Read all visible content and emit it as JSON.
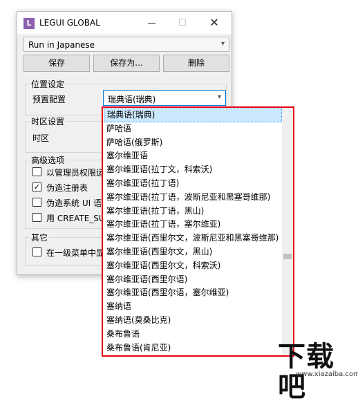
{
  "window": {
    "title": "LEGUI GLOBAL",
    "icon_letter": "L"
  },
  "profile_select": {
    "value": "Run in Japanese"
  },
  "buttons": {
    "save": "保存",
    "save_as": "保存为...",
    "delete": "删除"
  },
  "location_group": {
    "title": "位置设定",
    "preset_label": "预置配置",
    "preset_value": "瑞典语(瑞典)"
  },
  "timezone_group": {
    "title": "时区设置",
    "timezone_label": "时区"
  },
  "advanced_group": {
    "title": "高级选项",
    "options": [
      {
        "label": "以管理员权限运",
        "checked": false
      },
      {
        "label": "伪造注册表",
        "checked": true
      },
      {
        "label": "伪造系统 UI 语",
        "checked": false
      },
      {
        "label": "用 CREATE_SU",
        "checked": false
      }
    ]
  },
  "other_group": {
    "title": "其它",
    "options": [
      {
        "label": "在一级菜单中显",
        "checked": false
      }
    ]
  },
  "dropdown": {
    "selected_index": 0,
    "items": [
      "瑞典语(瑞典)",
      "萨哈语",
      "萨哈语(俄罗斯)",
      "塞尔维亚语",
      "塞尔维亚语(拉丁文，科索沃)",
      "塞尔维亚语(拉丁语)",
      "塞尔维亚语(拉丁语，波斯尼亚和黑塞哥维那)",
      "塞尔维亚语(拉丁语，黑山)",
      "塞尔维亚语(拉丁语，塞尔维亚)",
      "塞尔维亚语(西里尔文，波斯尼亚和黑塞哥维那)",
      "塞尔维亚语(西里尔文，黑山)",
      "塞尔维亚语(西里尔文，科索沃)",
      "塞尔维亚语(西里尔语)",
      "塞尔维亚语(西里尔语，塞尔维亚)",
      "塞纳语",
      "塞纳语(莫桑比克)",
      "桑布鲁语",
      "桑布鲁语(肯尼亚)"
    ]
  },
  "watermark": {
    "main": "下载吧",
    "sub": "www.xiazaiba.com"
  },
  "colors": {
    "highlight": "#e60012",
    "selection": "#cce8ff",
    "focus_border": "#0078d7"
  },
  "icons": {
    "dropdown_arrow": "chevron-down-icon",
    "close": "close-icon",
    "checkmark": "check-icon"
  }
}
